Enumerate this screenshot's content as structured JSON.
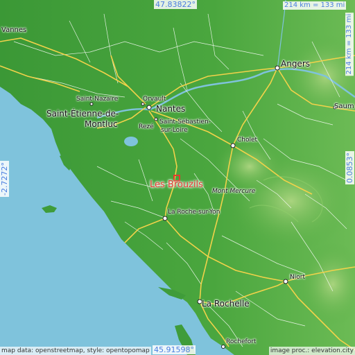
{
  "place_name": "Les Brouzils",
  "coordinates": {
    "top": "47.83822°",
    "bottom": "45.91598°",
    "left": "-2.7272°",
    "right": "0.0853°"
  },
  "scale": {
    "horizontal": "214 km = 133 mi",
    "vertical": "214 km = 133 mi"
  },
  "credits": {
    "left": "map data: openstreetmap, style: opentopomap",
    "right": "image proc.: elevation.city"
  },
  "cities": {
    "vannes": "Vannes",
    "angers": "Angers",
    "saumur": "Saum",
    "saint_nazaire": "Saint-Nazaire",
    "orvault": "Orvault",
    "nantes": "Nantes",
    "saint_etienne_1": "Saint-Étienne-de-",
    "saint_etienne_2": "Montluc",
    "reze": "Rezé",
    "saint_sebastien_1": "Saint-Sébastien-",
    "saint_sebastien_2": "sur-Loire",
    "cholet": "Cholet",
    "mont_mercure": "Mont Mercure",
    "la_roche": "La Roche-sur-Yon",
    "niort": "Niort",
    "la_rochelle": "La Rochelle",
    "rochefort": "Rochefort"
  },
  "colors": {
    "sea": "#7fc3dc",
    "land_low": "#3f9c3a",
    "land_high": "#9fd07a",
    "road_major": "#f2d24a",
    "road_minor": "#ffffff",
    "place_marker": "#e23a2f",
    "coord_text": "#4a7de0"
  }
}
